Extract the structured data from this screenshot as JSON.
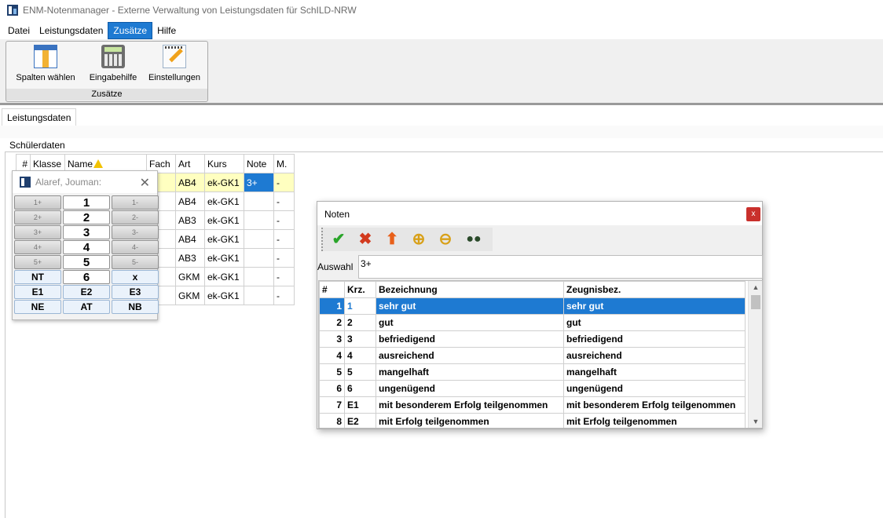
{
  "window": {
    "title": "ENM-Notenmanager - Externe Verwaltung von Leistungsdaten für SchILD-NRW"
  },
  "menu": [
    "Datei",
    "Leistungsdaten",
    "Zusätze",
    "Hilfe"
  ],
  "ribbon": {
    "buttons": [
      {
        "label": "Spalten wählen",
        "icon": "columns-grid-icon"
      },
      {
        "label": "Eingabehilfe",
        "icon": "calculator-icon"
      },
      {
        "label": "Einstellungen",
        "icon": "notepad-pencil-icon"
      }
    ],
    "group_label": "Zusätze"
  },
  "tab": {
    "label": "Leistungsdaten"
  },
  "section": {
    "label": "Schülerdaten"
  },
  "student_table": {
    "headers": [
      "#",
      "Klasse",
      "Name",
      "Fach",
      "Art",
      "Kurs",
      "Note",
      "M."
    ],
    "rows": [
      {
        "art": "AB4",
        "kurs": "ek-GK1",
        "note": "3+",
        "m": "-"
      },
      {
        "art": "AB4",
        "kurs": "ek-GK1",
        "note": "",
        "m": "-"
      },
      {
        "art": "AB3",
        "kurs": "ek-GK1",
        "note": "",
        "m": "-"
      },
      {
        "art": "AB4",
        "kurs": "ek-GK1",
        "note": "",
        "m": "-"
      },
      {
        "art": "AB3",
        "kurs": "ek-GK1",
        "note": "",
        "m": "-"
      },
      {
        "art": "GKM",
        "kurs": "ek-GK1",
        "note": "",
        "m": "-"
      },
      {
        "art": "GKM",
        "kurs": "ek-GK1",
        "note": "",
        "m": "-"
      }
    ]
  },
  "keypad": {
    "title": "Alaref, Jouman:",
    "keys": [
      "1+",
      "1",
      "1-",
      "2+",
      "2",
      "2-",
      "3+",
      "3",
      "3-",
      "4+",
      "4",
      "4-",
      "5+",
      "5",
      "5-",
      "NT",
      "6",
      "x",
      "E1",
      "E2",
      "E3",
      "NE",
      "AT",
      "NB"
    ]
  },
  "noten_dialog": {
    "title": "Noten",
    "close_label": "x",
    "toolbar": [
      "check-icon",
      "cancel-x-icon",
      "upload-arrow-icon",
      "zoom-in-icon",
      "zoom-out-icon",
      "binoculars-icon"
    ],
    "auswahl_label": "Auswahl",
    "auswahl_value": "3+",
    "headers": [
      "#",
      "Krz.",
      "Bezeichnung",
      "Zeugnisbez."
    ],
    "rows": [
      {
        "n": "1",
        "krz": "1",
        "bez": "sehr gut",
        "zeug": "sehr gut"
      },
      {
        "n": "2",
        "krz": "2",
        "bez": "gut",
        "zeug": "gut"
      },
      {
        "n": "3",
        "krz": "3",
        "bez": "befriedigend",
        "zeug": "befriedigend"
      },
      {
        "n": "4",
        "krz": "4",
        "bez": "ausreichend",
        "zeug": "ausreichend"
      },
      {
        "n": "5",
        "krz": "5",
        "bez": "mangelhaft",
        "zeug": "mangelhaft"
      },
      {
        "n": "6",
        "krz": "6",
        "bez": "ungenügend",
        "zeug": "ungenügend"
      },
      {
        "n": "7",
        "krz": "E1",
        "bez": "mit besonderem Erfolg teilgenommen",
        "zeug": "mit besonderem Erfolg teilgenommen"
      },
      {
        "n": "8",
        "krz": "E2",
        "bez": "mit Erfolg teilgenommen",
        "zeug": "mit Erfolg teilgenommen"
      }
    ]
  },
  "colors": {
    "accent": "#1e7ad2",
    "selection_row": "#ffffc0",
    "close_red": "#c9302c"
  }
}
